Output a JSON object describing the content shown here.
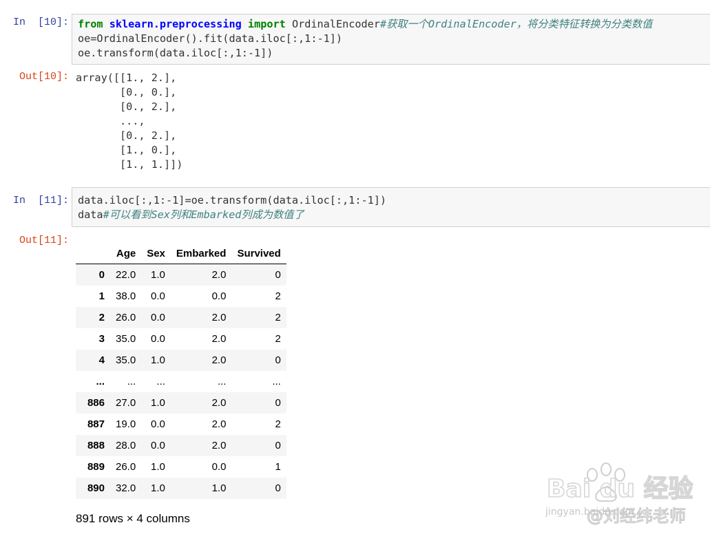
{
  "cells": [
    {
      "in_prompt": "In  [10]:",
      "code": {
        "line1_kw1": "from",
        "line1_mod": "sklearn.preprocessing",
        "line1_kw2": "import",
        "line1_rest": " OrdinalEncoder",
        "line1_comment": "#获取一个OrdinalEncoder，将分类特征转换为分类数值",
        "line2": "oe=OrdinalEncoder().fit(data.iloc[:,1:-1])",
        "line3": "oe.transform(data.iloc[:,1:-1])"
      },
      "out_prompt": "Out[10]:",
      "output_lines": [
        "array([[1., 2.],",
        "       [0., 0.],",
        "       [0., 2.],",
        "       ...,",
        "       [0., 2.],",
        "       [1., 0.],",
        "       [1., 1.]])"
      ]
    },
    {
      "in_prompt": "In  [11]:",
      "code": {
        "line1": "data.iloc[:,1:-1]=oe.transform(data.iloc[:,1:-1])",
        "line2_code": "data",
        "line2_comment": "#可以看到Sex列和Embarked列成为数值了"
      },
      "out_prompt": "Out[11]:"
    }
  ],
  "dataframe": {
    "columns": [
      "Age",
      "Sex",
      "Embarked",
      "Survived"
    ],
    "rows": [
      {
        "index": "0",
        "values": [
          "22.0",
          "1.0",
          "2.0",
          "0"
        ]
      },
      {
        "index": "1",
        "values": [
          "38.0",
          "0.0",
          "0.0",
          "2"
        ]
      },
      {
        "index": "2",
        "values": [
          "26.0",
          "0.0",
          "2.0",
          "2"
        ]
      },
      {
        "index": "3",
        "values": [
          "35.0",
          "0.0",
          "2.0",
          "2"
        ]
      },
      {
        "index": "4",
        "values": [
          "35.0",
          "1.0",
          "2.0",
          "0"
        ]
      },
      {
        "index": "...",
        "values": [
          "...",
          "...",
          "...",
          "..."
        ]
      },
      {
        "index": "886",
        "values": [
          "27.0",
          "1.0",
          "2.0",
          "0"
        ]
      },
      {
        "index": "887",
        "values": [
          "19.0",
          "0.0",
          "2.0",
          "2"
        ]
      },
      {
        "index": "888",
        "values": [
          "28.0",
          "0.0",
          "2.0",
          "0"
        ]
      },
      {
        "index": "889",
        "values": [
          "26.0",
          "1.0",
          "0.0",
          "1"
        ]
      },
      {
        "index": "890",
        "values": [
          "32.0",
          "1.0",
          "1.0",
          "0"
        ]
      }
    ],
    "summary": "891 rows × 4 columns"
  },
  "watermark": {
    "brand": "Bai du 经验",
    "url": "jingyan.baidu.com",
    "author": "@刘经纬老师"
  }
}
